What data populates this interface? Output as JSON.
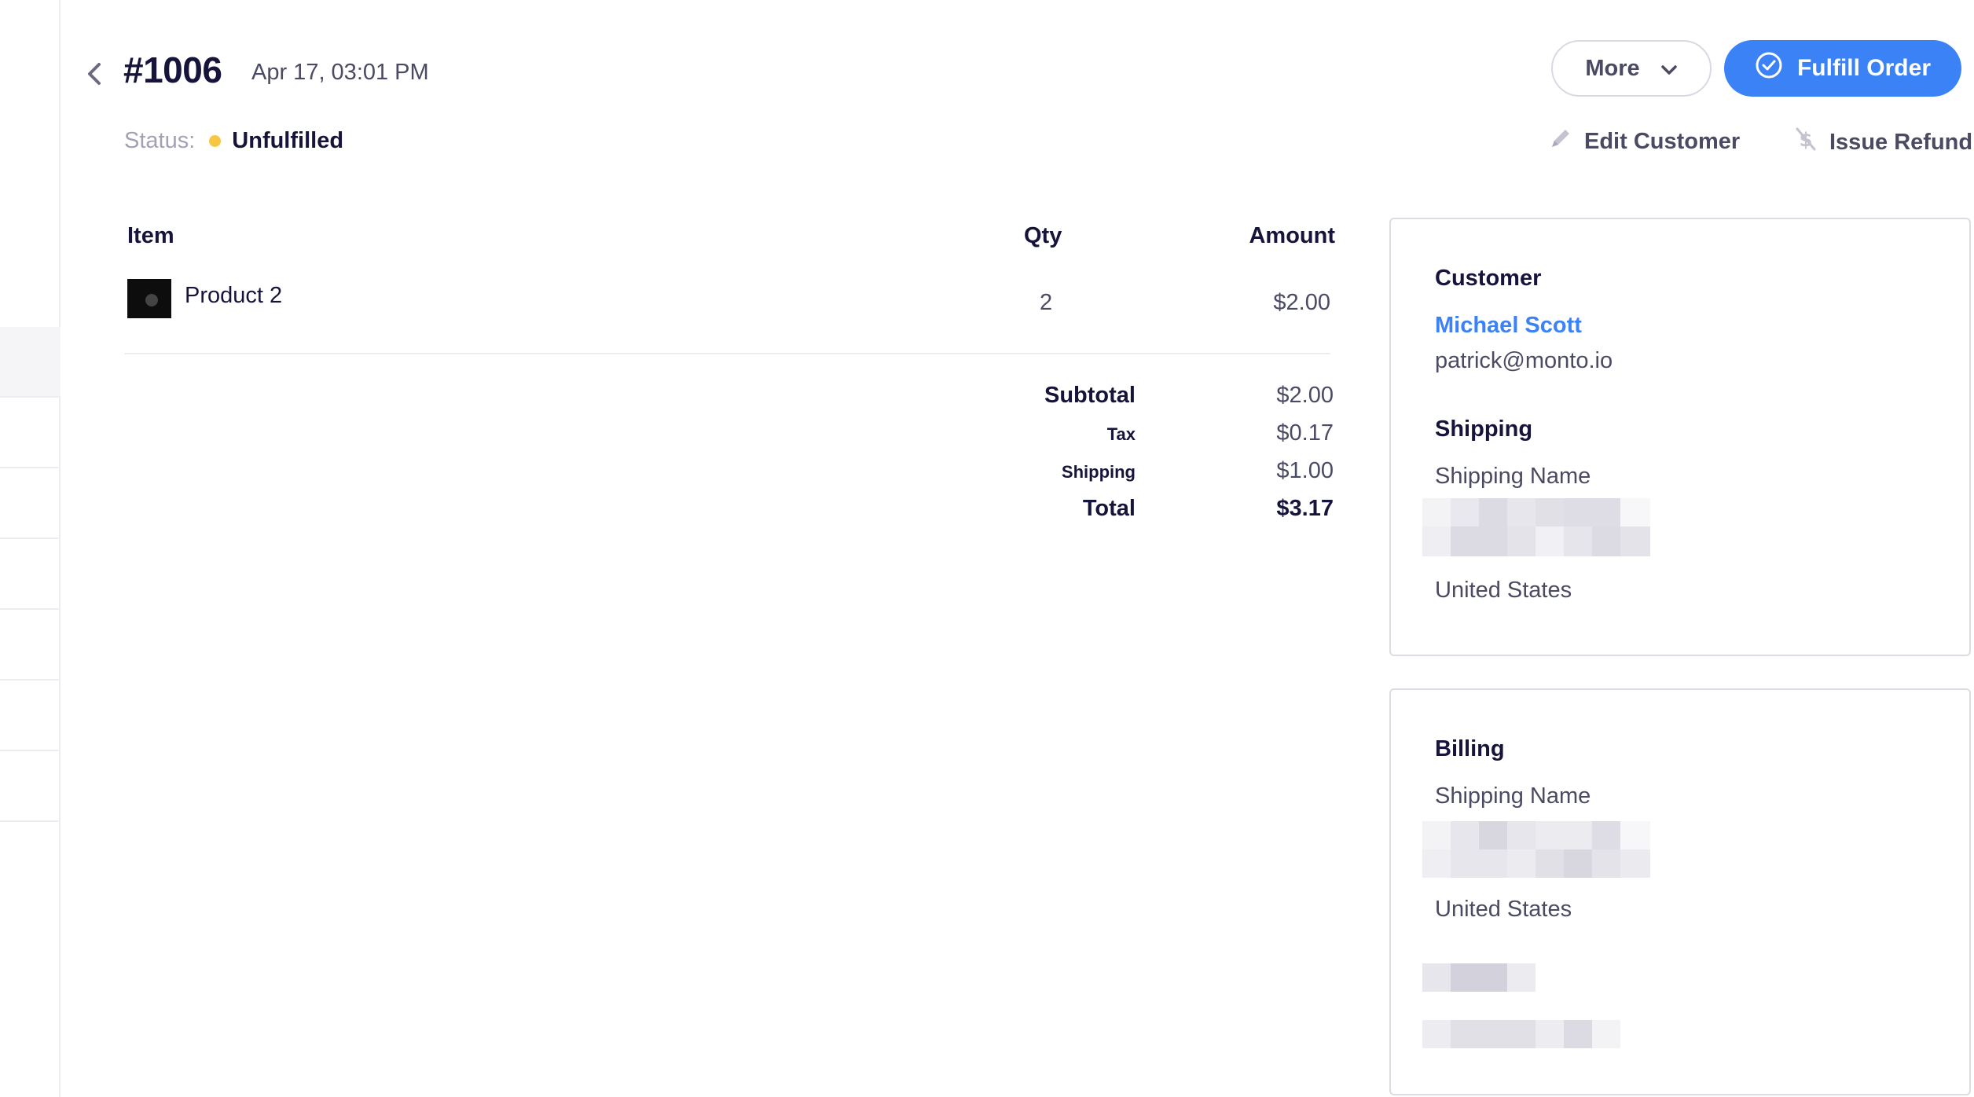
{
  "header": {
    "order_number": "#1006",
    "date": "Apr 17, 03:01 PM",
    "status_label": "Status:",
    "status_value": "Unfulfilled",
    "status_color": "#f6c745"
  },
  "actions": {
    "more_label": "More",
    "fulfill_label": "Fulfill Order",
    "edit_customer_label": "Edit Customer",
    "issue_refund_label": "Issue Refund",
    "accent_color": "#3b82f6"
  },
  "items_table": {
    "headers": [
      "Item",
      "Qty",
      "Amount"
    ],
    "rows": [
      {
        "name": "Product 2",
        "qty": "2",
        "amount": "$2.00"
      }
    ]
  },
  "summary": {
    "subtotal_label": "Subtotal",
    "subtotal_value": "$2.00",
    "tax_label": "Tax",
    "tax_value": "$0.17",
    "shipping_label": "Shipping",
    "shipping_value": "$1.00",
    "total_label": "Total",
    "total_value": "$3.17"
  },
  "customer_card": {
    "title": "Customer",
    "name": "Michael Scott",
    "email": "patrick@monto.io",
    "shipping_title": "Shipping",
    "shipping_name": "Shipping Name",
    "shipping_country": "United States"
  },
  "billing_card": {
    "title": "Billing",
    "billing_name": "Shipping Name",
    "billing_country": "United States"
  },
  "icons": {
    "back": "chevron-left-icon",
    "more": "chevron-down-icon",
    "fulfill": "check-circle-icon",
    "edit": "pencil-icon",
    "refund": "dollar-slash-icon"
  }
}
